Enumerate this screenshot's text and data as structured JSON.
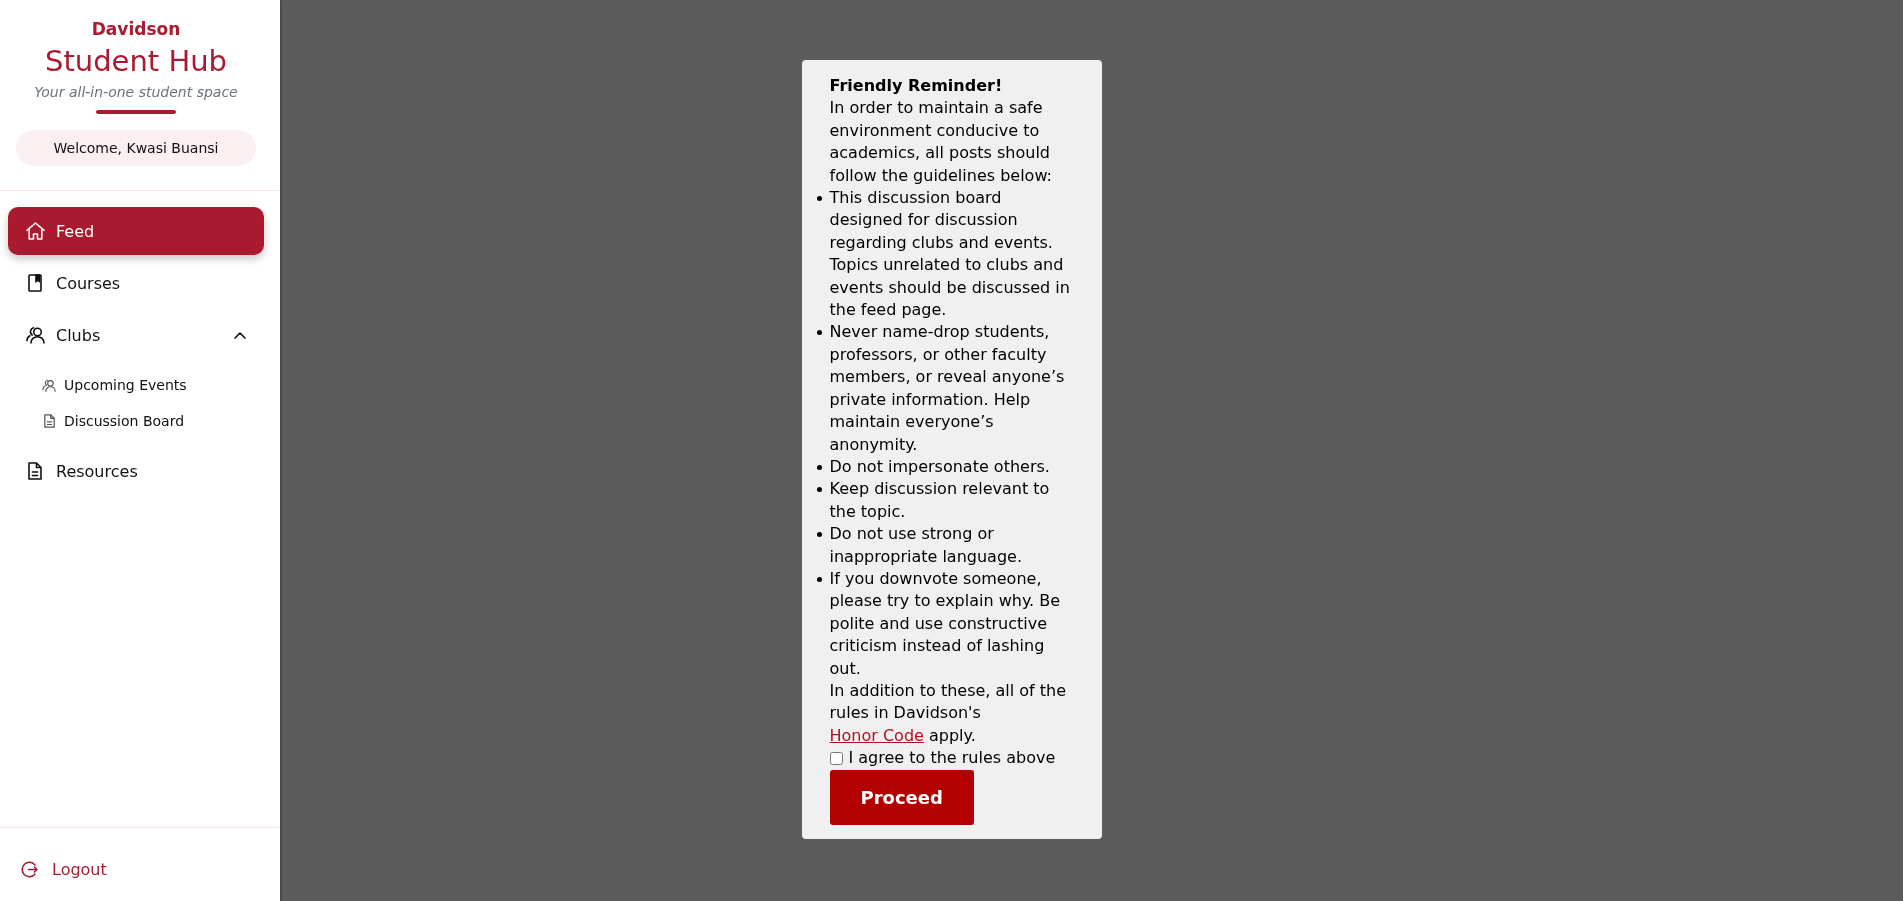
{
  "sidebar": {
    "brand": {
      "kicker": "Davidson",
      "title": "Student Hub",
      "tagline": "Your all-in-one student space"
    },
    "welcome": "Welcome, Kwasi Buansi",
    "nav": [
      {
        "label": "Feed",
        "selected": true
      },
      {
        "label": "Courses",
        "selected": false
      },
      {
        "label": "Clubs",
        "selected": false,
        "expanded": true,
        "children": [
          {
            "label": "Upcoming Events",
            "selected": false
          },
          {
            "label": "Discussion Board",
            "selected": false
          }
        ]
      },
      {
        "label": "Resources",
        "selected": false
      }
    ],
    "logout": "Logout"
  },
  "modal": {
    "title": "Friendly Reminder!",
    "intro": "In order to maintain a safe environment conducive to academics, all posts should follow the guidelines below:",
    "rules": [
      "This discussion board designed for discussion regarding clubs and events. Topics unrelated to clubs and events should be discussed in the feed page.",
      "Never name-drop students, professors, or other faculty members, or reveal anyone’s private information. Help maintain everyone’s anonymity.",
      "Do not impersonate others.",
      "Keep discussion relevant to the topic.",
      "Do not use strong or inappropriate language.",
      "If you downvote someone, please try to explain why. Be polite and use constructive criticism instead of lashing out."
    ],
    "closing": {
      "before": "In addition to these, all of the rules in Davidson's",
      "link": "Honor Code",
      "after": "apply."
    },
    "agreement": {
      "label": "I agree to the rules above",
      "checked": false
    },
    "button": "Proceed"
  }
}
